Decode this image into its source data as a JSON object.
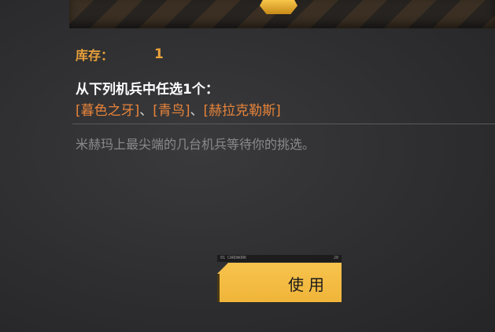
{
  "inventory": {
    "label": "库存：",
    "value": "1"
  },
  "selection": {
    "title": "从下列机兵中任选1个：",
    "options": [
      "[暮色之牙]",
      "[青鸟]",
      "[赫拉克勒斯]"
    ],
    "separator": "、"
  },
  "description": "米赫玛上最尖端的几台机兵等待你的挑选。",
  "use_button": {
    "label": "使用",
    "tag_left": "01 CARDWORK",
    "tag_right": "20"
  },
  "colors": {
    "accent_gold": "#e9a13b",
    "option_orange": "#e8843a",
    "button_yellow": "#f0b53a"
  },
  "icons": {
    "item": "gold-chest-icon"
  }
}
